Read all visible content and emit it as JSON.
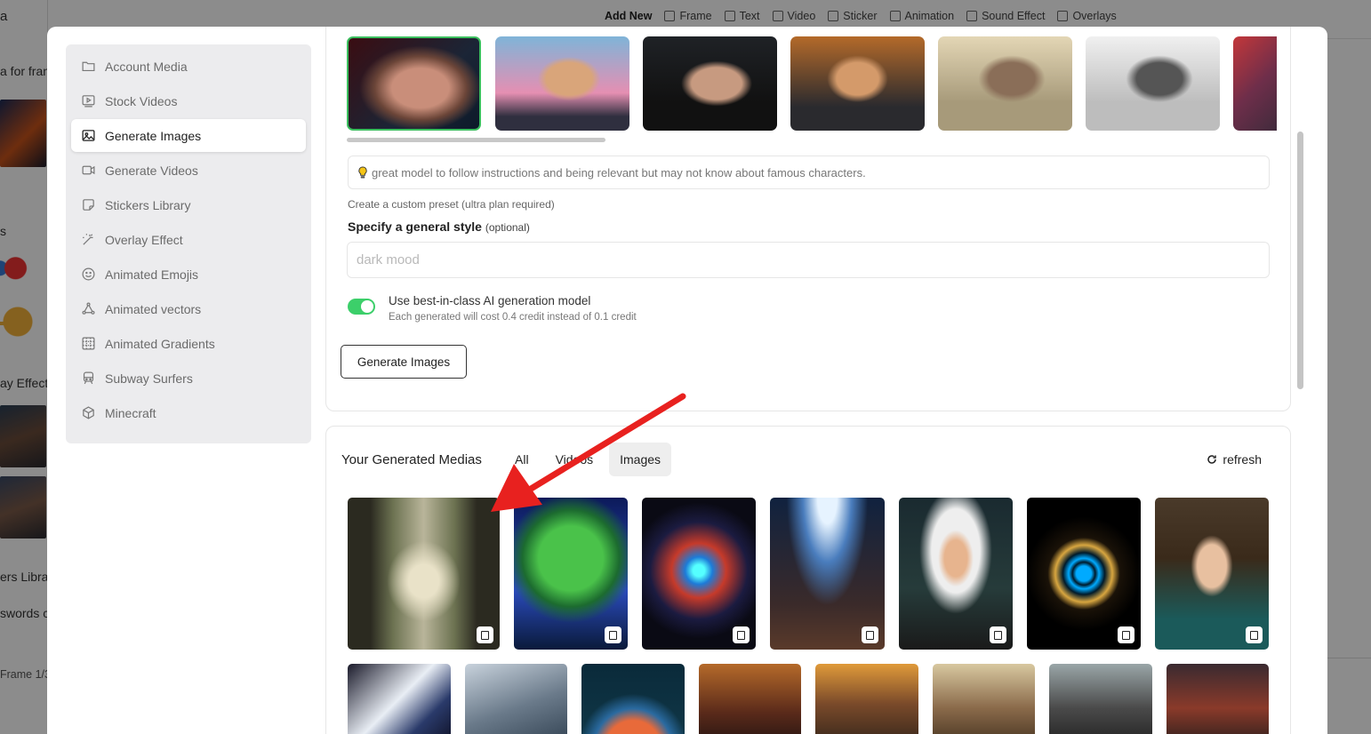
{
  "background": {
    "left_texts": [
      "a",
      "a for fran",
      "s",
      "ay Effect",
      "ers Libra",
      "swords c",
      "Frame 1/3"
    ],
    "toolbar": [
      {
        "label": "Add New",
        "icon": "none"
      },
      {
        "label": "Frame",
        "icon": "frame-icon"
      },
      {
        "label": "Text",
        "icon": "text-icon"
      },
      {
        "label": "Video",
        "icon": "video-icon"
      },
      {
        "label": "Sticker",
        "icon": "sticker-icon"
      },
      {
        "label": "Animation",
        "icon": "animation-icon"
      },
      {
        "label": "Sound Effect",
        "icon": "sound-effect-icon"
      },
      {
        "label": "Overlays",
        "icon": "overlays-icon"
      }
    ]
  },
  "sidebar": {
    "items": [
      {
        "label": "Account Media",
        "icon": "folder-icon"
      },
      {
        "label": "Stock Videos",
        "icon": "play-box-icon"
      },
      {
        "label": "Generate Images",
        "icon": "image-icon",
        "active": true
      },
      {
        "label": "Generate Videos",
        "icon": "video-camera-icon"
      },
      {
        "label": "Stickers Library",
        "icon": "sticker-icon"
      },
      {
        "label": "Overlay Effect",
        "icon": "magic-wand-icon"
      },
      {
        "label": "Animated Emojis",
        "icon": "smiley-icon"
      },
      {
        "label": "Animated vectors",
        "icon": "vector-nodes-icon"
      },
      {
        "label": "Animated Gradients",
        "icon": "gradient-icon"
      },
      {
        "label": "Subway Surfers",
        "icon": "train-icon"
      },
      {
        "label": "Minecraft",
        "icon": "cube-icon"
      }
    ]
  },
  "generate": {
    "model_hint": "great model to follow instructions and being relevant but may not know about famous characters.",
    "custom_preset_link": "Create a custom preset (ultra plan required)",
    "style_label": "Specify a general style",
    "style_label_optional": "(optional)",
    "style_placeholder": "dark mood",
    "toggle_label": "Use best-in-class AI generation model",
    "toggle_sub": "Each generated will cost 0.4 credit instead of 0.1 credit",
    "toggle_on": true,
    "button_label": "Generate Images"
  },
  "media": {
    "title": "Your Generated Medias",
    "tabs": [
      "All",
      "Videos",
      "Images"
    ],
    "active_tab": "Images",
    "refresh_label": "refresh"
  },
  "colors": {
    "accent_green": "#3ccf6a",
    "selected_border": "#3bbf5e",
    "arrow_red": "#e8211f"
  }
}
